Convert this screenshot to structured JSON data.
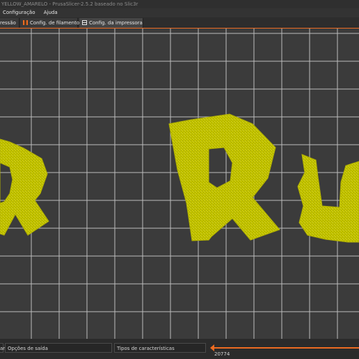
{
  "window": {
    "title": "YELLOW_AMARELO - PrusaSlicer-2.5.2 baseado no Slic3r"
  },
  "menu": {
    "items": [
      "Configuração",
      "Ajuda"
    ]
  },
  "tabs": [
    {
      "label": "ressão",
      "icon": "print-settings-icon"
    },
    {
      "label": "Config. de filamento",
      "icon": "filament-spool-icon"
    },
    {
      "label": "Config. da impressora",
      "icon": "printer-icon"
    }
  ],
  "colors": {
    "accent": "#ed6b21",
    "model": "#c4c400",
    "bed": "#3b3b3b",
    "grid": "#bdbdbd"
  },
  "bottom": {
    "partial_label": "ar",
    "output_options": "Opções de saída",
    "feature_types": "Tipos de características",
    "layer_value": "20774"
  }
}
